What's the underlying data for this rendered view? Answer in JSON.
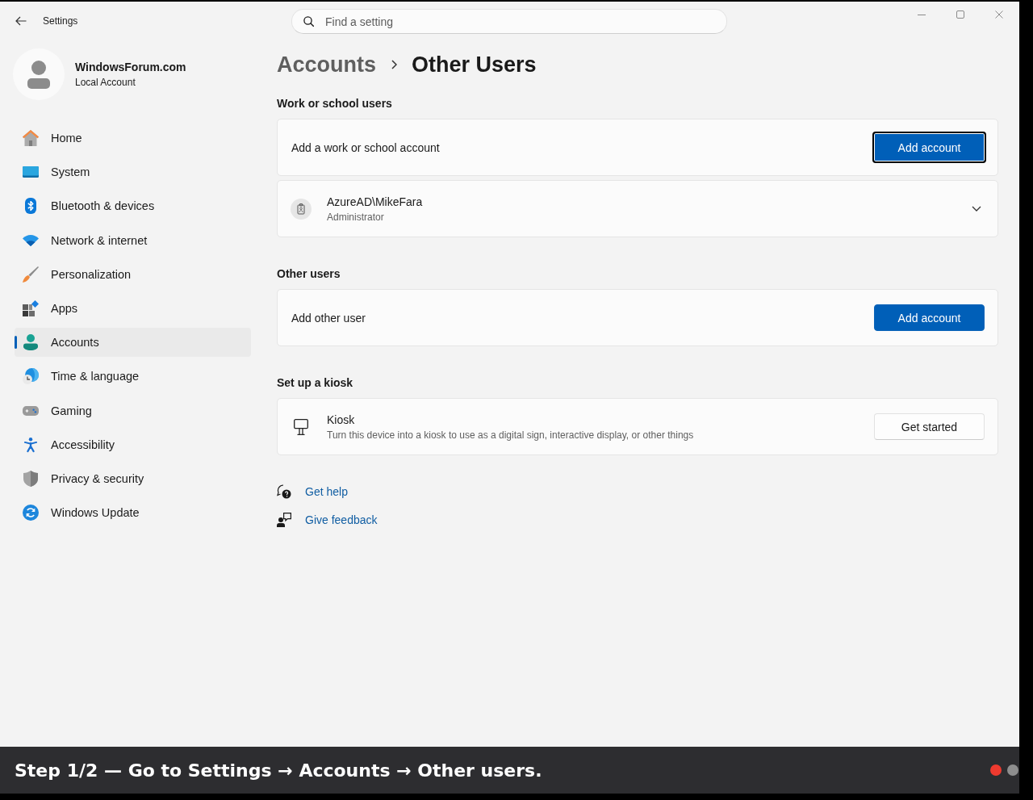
{
  "window": {
    "title": "Settings"
  },
  "search": {
    "placeholder": "Find a setting"
  },
  "profile": {
    "name": "WindowsForum.com",
    "account_type": "Local Account"
  },
  "sidebar": {
    "items": [
      {
        "kind": "home",
        "label": "Home",
        "selected": false
      },
      {
        "kind": "system",
        "label": "System",
        "selected": false
      },
      {
        "kind": "bluetooth",
        "label": "Bluetooth & devices",
        "selected": false
      },
      {
        "kind": "network",
        "label": "Network & internet",
        "selected": false
      },
      {
        "kind": "personalization",
        "label": "Personalization",
        "selected": false
      },
      {
        "kind": "apps",
        "label": "Apps",
        "selected": false
      },
      {
        "kind": "accounts",
        "label": "Accounts",
        "selected": true
      },
      {
        "kind": "time",
        "label": "Time & language",
        "selected": false
      },
      {
        "kind": "gaming",
        "label": "Gaming",
        "selected": false
      },
      {
        "kind": "accessibility",
        "label": "Accessibility",
        "selected": false
      },
      {
        "kind": "privacy",
        "label": "Privacy & security",
        "selected": false
      },
      {
        "kind": "update",
        "label": "Windows Update",
        "selected": false
      }
    ]
  },
  "breadcrumb": {
    "parent": "Accounts",
    "current": "Other Users"
  },
  "sections": [
    {
      "heading": "Work or school users",
      "cards": [
        {
          "kind": "action",
          "label": "Add a work or school account",
          "button": {
            "label": "Add account",
            "kind": "primary",
            "focused": true
          }
        },
        {
          "kind": "user",
          "name": "AzureAD\\MikeFara",
          "role": "Administrator",
          "expanded": false
        }
      ]
    },
    {
      "heading": "Other users",
      "cards": [
        {
          "kind": "action",
          "label": "Add other user",
          "button": {
            "label": "Add account",
            "kind": "primary",
            "focused": false
          }
        }
      ]
    },
    {
      "heading": "Set up a kiosk",
      "cards": [
        {
          "kind": "kiosk",
          "title": "Kiosk",
          "description": "Turn this device into a kiosk to use as a digital sign, interactive display, or other things",
          "button": {
            "label": "Get started",
            "kind": "secondary",
            "focused": false
          }
        }
      ]
    }
  ],
  "links": [
    {
      "kind": "help",
      "label": "Get help"
    },
    {
      "kind": "feedback",
      "label": "Give feedback"
    }
  ],
  "caption": {
    "text": "Step 1/2 — Go to Settings → Accounts → Other users.",
    "steps": [
      {
        "selected": true
      },
      {
        "selected": false
      }
    ]
  }
}
